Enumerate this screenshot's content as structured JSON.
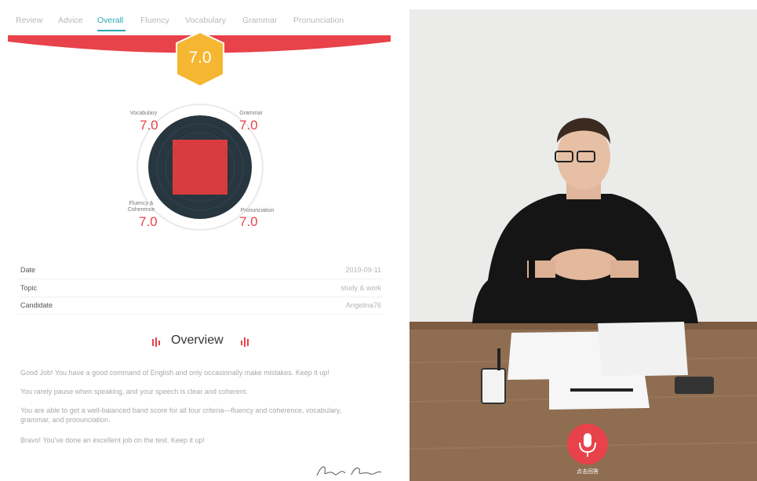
{
  "tabs": [
    {
      "label": "Review",
      "active": false
    },
    {
      "label": "Advice",
      "active": false
    },
    {
      "label": "Overall",
      "active": true
    },
    {
      "label": "Fluency",
      "active": false
    },
    {
      "label": "Vocabulary",
      "active": false
    },
    {
      "label": "Grammar",
      "active": false
    },
    {
      "label": "Pronunciation",
      "active": false
    }
  ],
  "overall_score": "7.0",
  "criteria": {
    "vocabulary": {
      "label": "Vocabulary",
      "score": "7.0"
    },
    "grammar": {
      "label": "Grammar",
      "score": "7.0"
    },
    "fluency": {
      "label": "Fluency & Coherence",
      "score": "7.0"
    },
    "pronunciation": {
      "label": "Pronunciation",
      "score": "7.0"
    }
  },
  "info": [
    {
      "key": "Date",
      "value": "2019-09-11"
    },
    {
      "key": "Topic",
      "value": "study & work"
    },
    {
      "key": "Candidate",
      "value": "Angelina76"
    }
  ],
  "overview_title": "Overview",
  "paragraphs": [
    "Good Job! You have a good command of English and only occasionally make mistakes. Keep it up!",
    "You rarely pause when speaking, and your speech is clear and coherent.",
    "You are able to get a well-balanced band score for all four criteria—fluency and coherence, vocabulary, grammar, and pronunciation.",
    "Bravo! You've done an excellent job on the test. Keep it up!"
  ],
  "mic_caption": "点击回答",
  "colors": {
    "accent": "#2aa6b4",
    "red": "#e8424a",
    "gold": "#f5b731",
    "dark": "#27363f"
  },
  "icons": {
    "mic": "microphone-icon"
  }
}
